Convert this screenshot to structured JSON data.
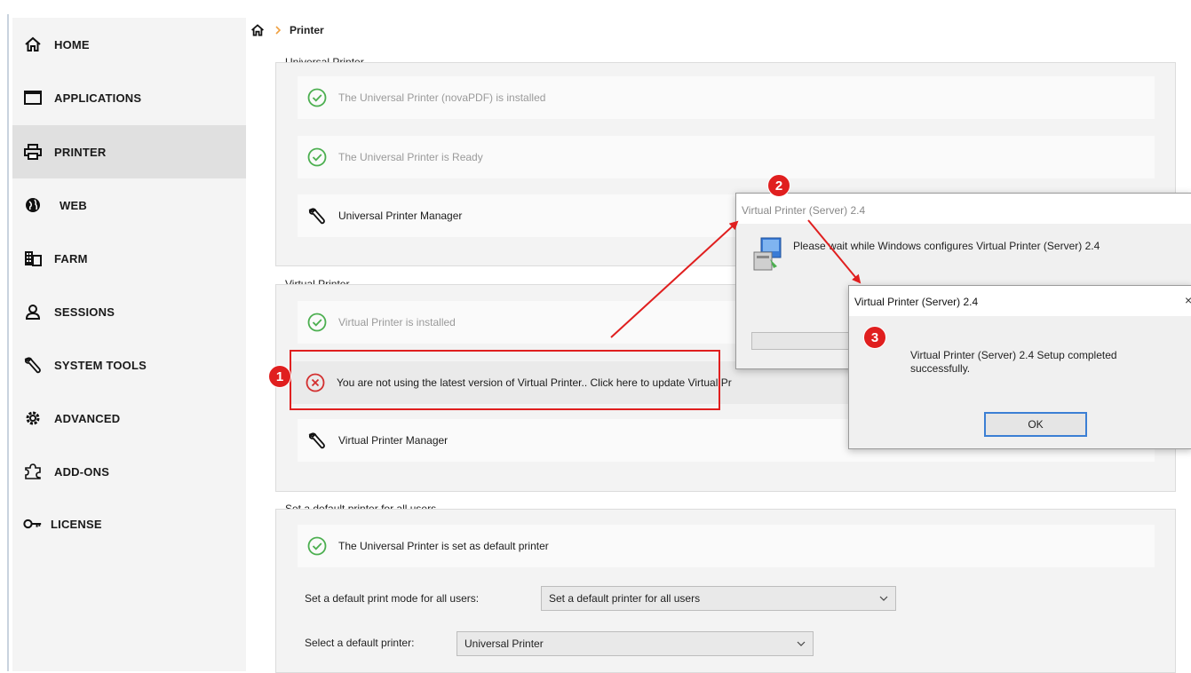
{
  "sidebar": {
    "items": [
      {
        "label": "HOME",
        "icon": "home-icon"
      },
      {
        "label": "APPLICATIONS",
        "icon": "window-icon"
      },
      {
        "label": "PRINTER",
        "icon": "printer-icon",
        "active": true
      },
      {
        "label": "WEB",
        "icon": "globe-icon"
      },
      {
        "label": "FARM",
        "icon": "building-icon"
      },
      {
        "label": "SESSIONS",
        "icon": "user-icon"
      },
      {
        "label": "SYSTEM TOOLS",
        "icon": "wrench-icon"
      },
      {
        "label": "ADVANCED",
        "icon": "gear-icon"
      },
      {
        "label": "ADD-ONS",
        "icon": "puzzle-icon"
      },
      {
        "label": "LICENSE",
        "icon": "key-icon"
      }
    ]
  },
  "breadcrumb": {
    "current": "Printer"
  },
  "universal": {
    "title": "Universal Printer",
    "installed": "The Universal Printer (novaPDF) is installed",
    "ready": "The Universal Printer is Ready",
    "manager": "Universal Printer Manager"
  },
  "virtual": {
    "title": "Virtual Printer",
    "installed": "Virtual Printer is installed",
    "update": "You are not using the latest version of Virtual Printer.. Click here to update Virtual Pr",
    "manager": "Virtual Printer Manager"
  },
  "defaults": {
    "title": "Set a default printer for all users",
    "status": "The Universal Printer is set as default printer",
    "mode_label": "Set a default print mode for all users:",
    "mode_value": "Set a default printer for all users",
    "printer_label": "Select a default printer:",
    "printer_value": "Universal Printer"
  },
  "dialog_installing": {
    "title": "Virtual Printer (Server) 2.4",
    "message": "Please wait while Windows configures Virtual Printer (Server) 2.4"
  },
  "dialog_complete": {
    "title": "Virtual Printer (Server) 2.4",
    "close": "×",
    "message": "Virtual Printer (Server) 2.4 Setup completed successfully.",
    "ok": "OK"
  },
  "annotations": {
    "step1": "1",
    "step2": "2",
    "step3": "3"
  },
  "colors": {
    "accent_red": "#e01f1f",
    "check_green": "#4caf50",
    "error_red": "#d32f2f",
    "breadcrumb_arrow": "#f0a040"
  }
}
